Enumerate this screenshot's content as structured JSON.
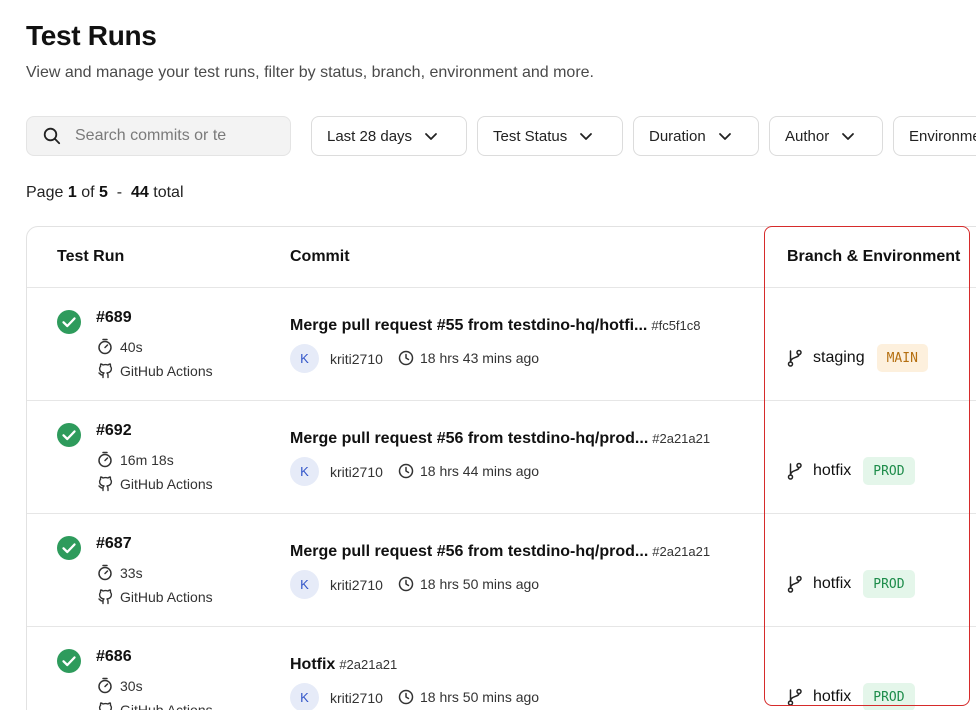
{
  "page": {
    "title": "Test Runs",
    "subtitle": "View and manage your test runs, filter by status, branch, environment and more."
  },
  "search": {
    "placeholder": "Search commits or te"
  },
  "filters": [
    {
      "label": "Last 28 days"
    },
    {
      "label": "Test Status"
    },
    {
      "label": "Duration"
    },
    {
      "label": "Author"
    },
    {
      "label": "Environme"
    }
  ],
  "pagination": {
    "prefix": "Page",
    "current": "1",
    "of": "of",
    "total_pages": "5",
    "sep": "-",
    "total_count": "44",
    "total_label": "total"
  },
  "table": {
    "columns": [
      "Test Run",
      "Commit",
      "Branch & Environment"
    ],
    "rows": [
      {
        "status": "passed",
        "run_id": "#689",
        "duration": "40s",
        "ci": "GitHub Actions",
        "commit_message": "Merge pull request #55 from testdino-hq/hotfi...",
        "commit_hash": "#fc5f1c8",
        "author_initial": "K",
        "author": "kriti2710",
        "time_ago": "18 hrs 43 mins ago",
        "branch": "staging",
        "environment": "MAIN",
        "env_color": "#b56f10"
      },
      {
        "status": "passed",
        "run_id": "#692",
        "duration": "16m 18s",
        "ci": "GitHub Actions",
        "commit_message": "Merge pull request #56 from testdino-hq/prod...",
        "commit_hash": "#2a21a21",
        "author_initial": "K",
        "author": "kriti2710",
        "time_ago": "18 hrs 44 mins ago",
        "branch": "hotfix",
        "environment": "PROD",
        "env_color": "#1d8c4a"
      },
      {
        "status": "passed",
        "run_id": "#687",
        "duration": "33s",
        "ci": "GitHub Actions",
        "commit_message": "Merge pull request #56 from testdino-hq/prod...",
        "commit_hash": "#2a21a21",
        "author_initial": "K",
        "author": "kriti2710",
        "time_ago": "18 hrs 50 mins ago",
        "branch": "hotfix",
        "environment": "PROD",
        "env_color": "#1d8c4a"
      },
      {
        "status": "passed",
        "run_id": "#686",
        "duration": "30s",
        "ci": "GitHub Actions",
        "commit_message": "Hotfix",
        "commit_hash": "#2a21a21",
        "author_initial": "K",
        "author": "kriti2710",
        "time_ago": "18 hrs 50 mins ago",
        "branch": "hotfix",
        "environment": "PROD",
        "env_color": "#1d8c4a"
      }
    ]
  },
  "colors": {
    "success": "#2e9b5c",
    "highlight": "#d62b2b",
    "avatar_bg": "#e6ebf8",
    "avatar_text": "#3255c9"
  }
}
